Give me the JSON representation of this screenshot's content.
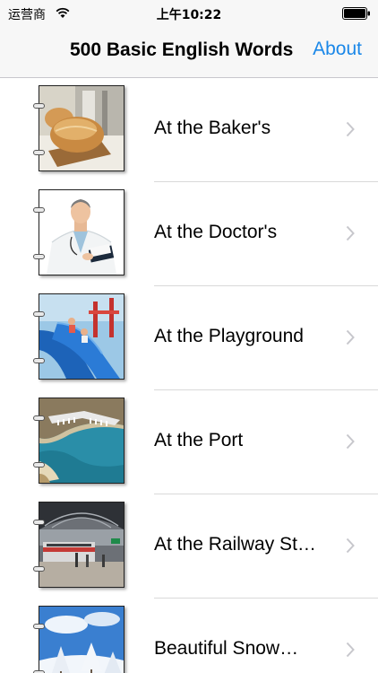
{
  "status_bar": {
    "carrier": "运营商",
    "time": "上午10:22",
    "icons": [
      "wifi-icon",
      "battery-icon"
    ]
  },
  "nav": {
    "title": "500 Basic English Words",
    "about_label": "About"
  },
  "colors": {
    "accent": "#1a87e8",
    "nav_background": "#f7f7f7",
    "separator": "#d9d9d9",
    "chevron": "#c7c7cc"
  },
  "items": [
    {
      "label": "At the Baker's",
      "thumbnail": "bread-loaf-image"
    },
    {
      "label": "At the Doctor's",
      "thumbnail": "doctor-image"
    },
    {
      "label": "At the Playground",
      "thumbnail": "playground-slide-image"
    },
    {
      "label": "At the Port",
      "thumbnail": "harbor-aerial-image"
    },
    {
      "label": "At the Railway St…",
      "thumbnail": "railway-station-image"
    },
    {
      "label": "Beautiful Snow…",
      "thumbnail": "snowy-trees-image"
    }
  ]
}
